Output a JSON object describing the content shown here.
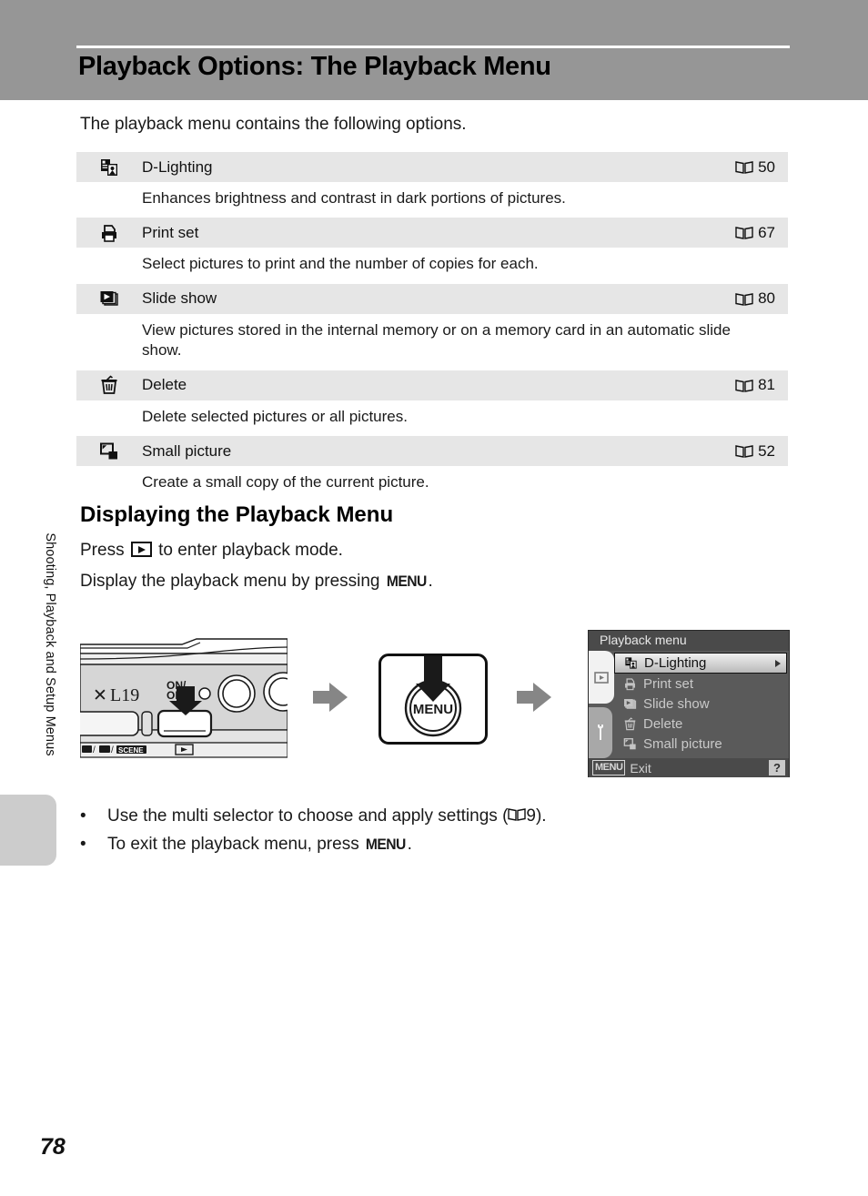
{
  "page": {
    "title": "Playback Options: The Playback Menu",
    "number": "78",
    "side_tab_label": "Shooting, Playback and Setup Menus",
    "intro": "The playback menu contains the following options."
  },
  "options_table": {
    "rows": [
      {
        "icon": "d-lighting-icon",
        "name": "D-Lighting",
        "ref_icon": "book-icon",
        "ref_page": "50",
        "description": "Enhances brightness and contrast in dark portions of pictures."
      },
      {
        "icon": "print-set-icon",
        "name": "Print set",
        "ref_icon": "book-icon",
        "ref_page": "67",
        "description": "Select pictures to print and the number of copies for each."
      },
      {
        "icon": "slide-show-icon",
        "name": "Slide show",
        "ref_icon": "book-icon",
        "ref_page": "80",
        "description": "View pictures stored in the internal memory or on a memory card in an automatic slide show."
      },
      {
        "icon": "delete-icon",
        "name": "Delete",
        "ref_icon": "book-icon",
        "ref_page": "81",
        "description": "Delete selected pictures or all pictures."
      },
      {
        "icon": "small-picture-icon",
        "name": "Small picture",
        "ref_icon": "book-icon",
        "ref_page": "52",
        "description": "Create a small copy of the current picture."
      }
    ]
  },
  "section": {
    "heading": "Displaying the Playback Menu",
    "line1_before": "Press ",
    "line1_after": " to enter playback mode.",
    "line2_before": "Display the playback menu by pressing ",
    "line2_menu": "MENU",
    "line2_after": "."
  },
  "illustration": {
    "camera_model_text": "L19",
    "camera_power_label_top": "ON/",
    "camera_power_label_bottom": "OFF",
    "camera_mode_strip": "/ /SCENE",
    "menu_button_label": "MENU",
    "arrow_icon": "arrow-right-icon"
  },
  "lcd": {
    "title": "Playback menu",
    "items": [
      {
        "icon": "d-lighting-icon",
        "label": "D-Lighting",
        "selected": true
      },
      {
        "icon": "print-set-icon",
        "label": "Print set",
        "selected": false
      },
      {
        "icon": "slide-show-icon",
        "label": "Slide show",
        "selected": false
      },
      {
        "icon": "delete-icon",
        "label": "Delete",
        "selected": false
      },
      {
        "icon": "small-picture-icon",
        "label": "Small picture",
        "selected": false
      }
    ],
    "tabs": [
      {
        "icon": "playback-tab-icon",
        "active": true
      },
      {
        "icon": "setup-wrench-tab-icon",
        "active": false
      }
    ],
    "footer_chip": "MENU",
    "footer_text": "Exit",
    "help_chip": "?"
  },
  "bullets": [
    {
      "before": "Use the multi selector to choose and apply settings (",
      "ref_icon": "book-icon",
      "ref_page": "9",
      "after": ")."
    },
    {
      "before": "To exit the playback menu, press ",
      "menu": "MENU",
      "after": "."
    }
  ],
  "colors": {
    "header_band": "#969696",
    "row_background": "#e6e6e6",
    "side_tab": "#cccccc",
    "lcd_background": "#5a5a5a"
  }
}
